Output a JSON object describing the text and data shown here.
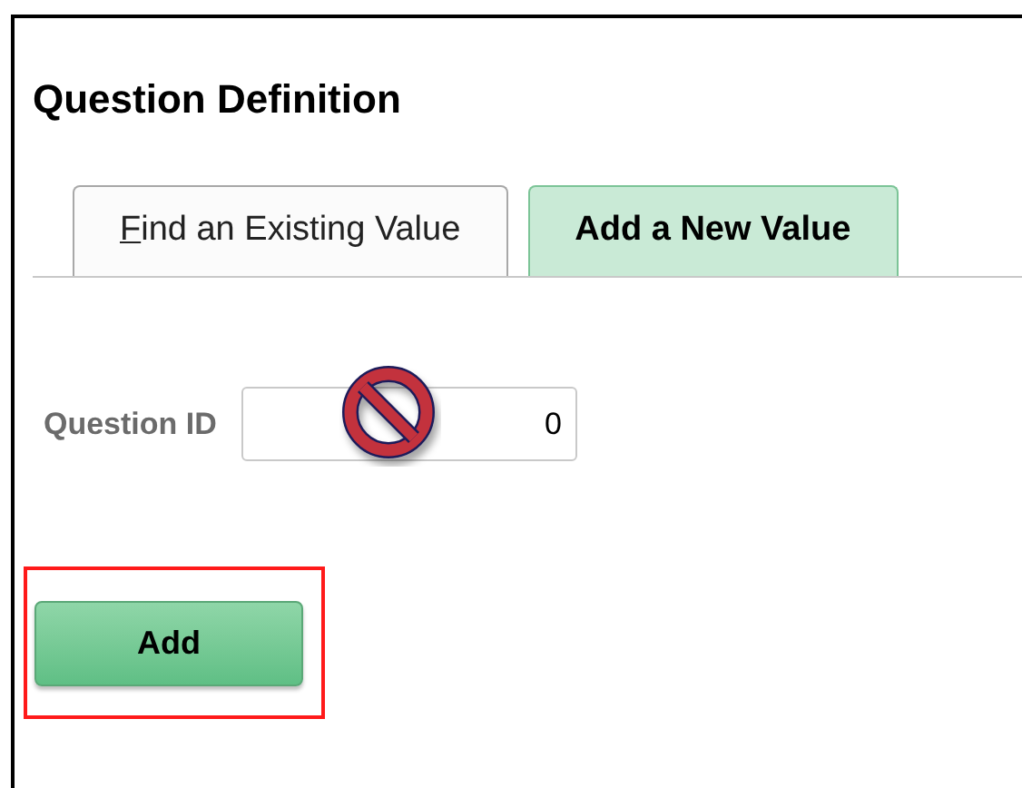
{
  "page_title": "Question Definition",
  "tabs": [
    {
      "label": "Find an Existing Value",
      "selected": false
    },
    {
      "label": "Add a New Value",
      "selected": true
    }
  ],
  "fields": [
    {
      "label": "Question ID",
      "value": "0"
    }
  ],
  "add_button": {
    "label": "Add",
    "highlighted": true
  }
}
